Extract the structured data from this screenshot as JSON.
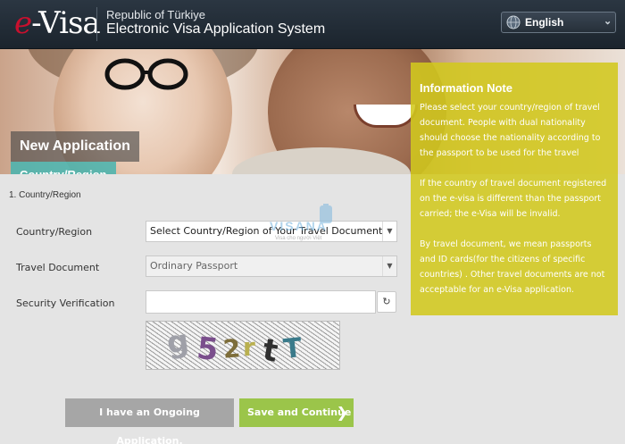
{
  "header": {
    "logo_prefix": "e",
    "logo_text": "-Visa",
    "subtitle": "Republic of Türkiye",
    "title": "Electronic Visa Application System",
    "language": {
      "selected": "English",
      "icon": "globe-icon"
    }
  },
  "banner": {
    "section_title": "New Application",
    "active_tab": "Country/Region"
  },
  "info_note": {
    "title": "Information Note",
    "paragraphs": [
      "Please select your country/region of travel document. People with dual nationality should choose the nationality according to the passport to be used for the travel",
      "If the country of travel document registered on the e-visa is different than the passport carried; the e-Visa will be invalid.",
      "By travel document, we mean passports and ID cards(for the citizens of specific countries) . Other travel documents are not acceptable for an e-Visa application."
    ]
  },
  "form": {
    "step": "1. Country/Region",
    "country": {
      "label": "Country/Region",
      "value": "Select Country/Region of Your Travel Document"
    },
    "document": {
      "label": "Travel Document",
      "value": "Ordinary Passport"
    },
    "security": {
      "label": "Security Verification",
      "value": "",
      "captcha_text": "g52rtT"
    }
  },
  "watermark": {
    "brand": "VISANA",
    "tagline": "Visa cho người Việt"
  },
  "buttons": {
    "ongoing": "I have an Ongoing Application.",
    "save": "Save and Continue"
  },
  "colors": {
    "header_bg": "#1f2a34",
    "logo_red": "#c8102e",
    "info_bg": "#d2c81e",
    "tab_teal": "#46b4af",
    "save_green": "#9bc54a",
    "ongoing_gray": "#a6a6a6"
  }
}
